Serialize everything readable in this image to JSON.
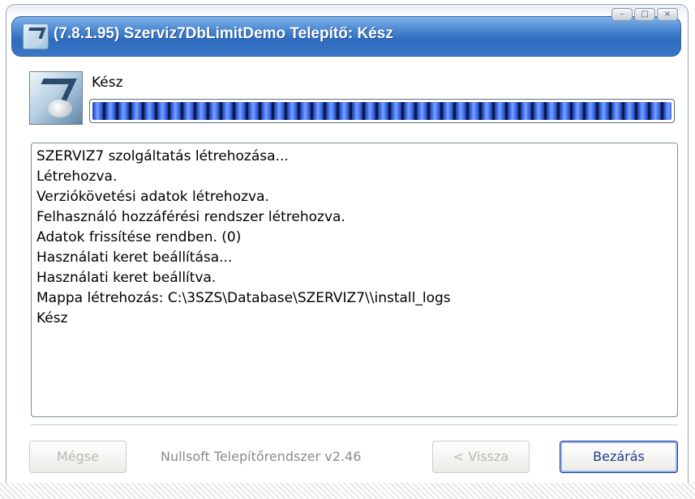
{
  "window": {
    "title": "(7.8.1.95) Szerviz7DbLimitDemo Telepítő: Kész",
    "minimize_glyph": "–",
    "maximize_glyph": "□",
    "close_glyph": "×"
  },
  "header": {
    "status_label": "Kész",
    "progress": 1.0
  },
  "log": {
    "lines": [
      "SZERVIZ7 szolgáltatás létrehozása...",
      "Létrehozva.",
      "Verziókövetési adatok létrehozva.",
      "Felhasználó hozzáférési rendszer létrehozva.",
      "Adatok frissítése rendben. (0)",
      "Használati keret beállítása...",
      "Használati keret beállítva.",
      "Mappa létrehozás: C:\\3SZS\\Database\\SZERVIZ7\\\\install_logs",
      "Kész"
    ]
  },
  "footer": {
    "cancel_label": "Mégse",
    "branding": "Nullsoft Telepítőrendszer v2.46",
    "back_label": "< Vissza",
    "close_label": "Bezárás"
  },
  "colors": {
    "title_bar": "#3b77c6",
    "progress_fill": "#3f6cf0",
    "default_button_border": "#1b3c9e"
  },
  "icons": [
    "app-icon",
    "installer-header-icon",
    "minimize-icon",
    "maximize-icon",
    "close-icon"
  ]
}
